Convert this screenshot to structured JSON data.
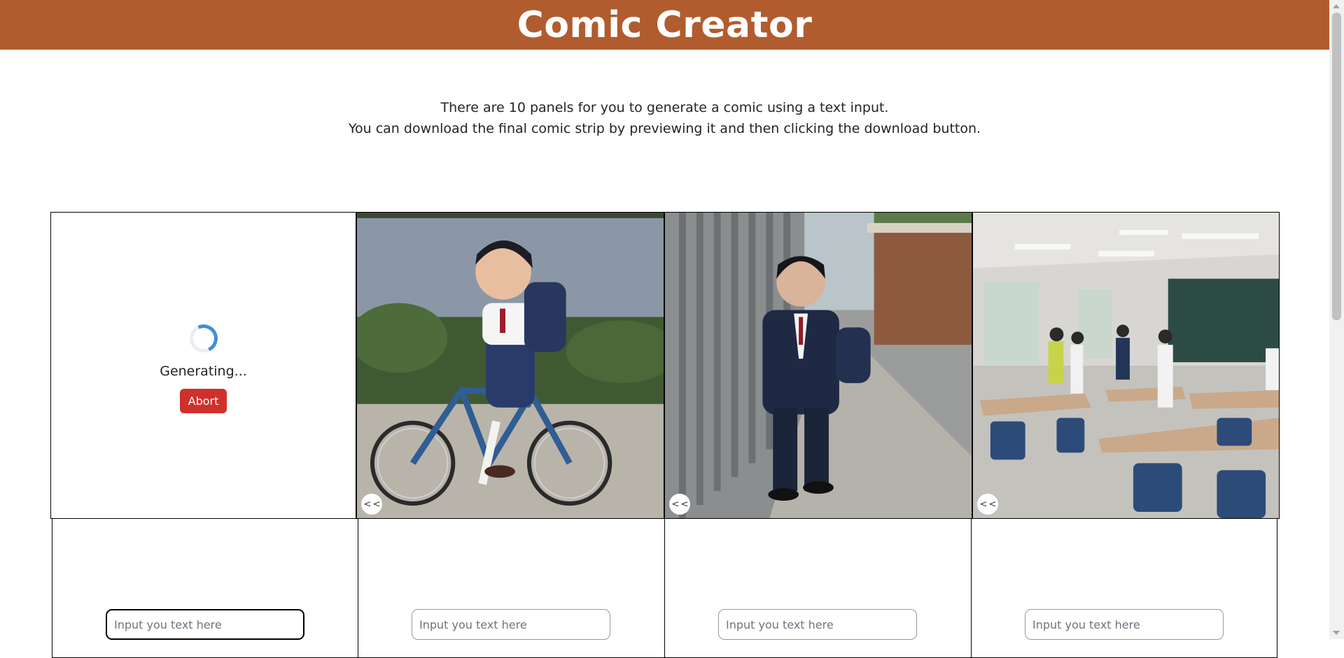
{
  "header": {
    "title": "Comic Creator",
    "bg_color": "#b15c2f"
  },
  "intro": {
    "line1": "There are 10 panels for you to generate a comic using a text input.",
    "line2": "You can download the final comic strip by previewing it and then clicking the download button."
  },
  "panels": [
    {
      "state": "generating",
      "status_text": "Generating...",
      "abort_label": "Abort"
    },
    {
      "state": "image",
      "image": "boy-riding-bicycle",
      "prev_label": "< <"
    },
    {
      "state": "image",
      "image": "boy-walking-to-school",
      "prev_label": "< <"
    },
    {
      "state": "image",
      "image": "classroom-with-students",
      "prev_label": "< <"
    }
  ],
  "inputs": [
    {
      "placeholder": "Input you text here",
      "value": ""
    },
    {
      "placeholder": "Input you text here",
      "value": ""
    },
    {
      "placeholder": "Input you text here",
      "value": ""
    },
    {
      "placeholder": "Input you text here",
      "value": ""
    }
  ],
  "colors": {
    "abort": "#d0302b",
    "spinner": "#3d8fd6"
  }
}
